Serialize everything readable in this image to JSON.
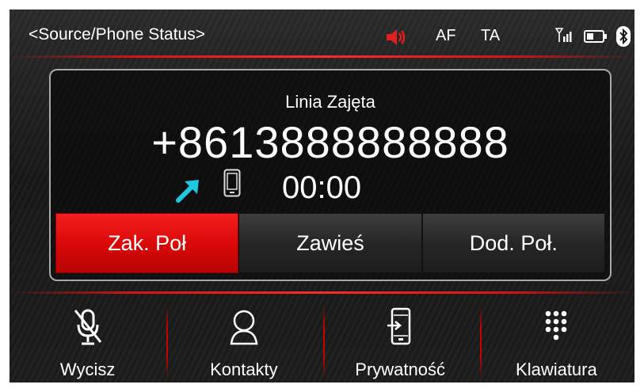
{
  "statusbar": {
    "source_label": "<Source/Phone Status>",
    "af": "AF",
    "ta": "TA",
    "icons": [
      "speaker-muted-icon",
      "signal-icon",
      "battery-icon",
      "bluetooth-icon"
    ]
  },
  "call": {
    "status": "Linia Zajęta",
    "number": "+8613888888888",
    "timer": "00:00",
    "direction_icon": "outgoing-call-arrow-icon",
    "device_icon": "mobile-phone-icon"
  },
  "actions": [
    {
      "label": "Zak. Poł",
      "active": true
    },
    {
      "label": "Zawieś",
      "active": false
    },
    {
      "label": "Dod. Poł.",
      "active": false
    }
  ],
  "dock": [
    {
      "label": "Wycisz",
      "icon": "mic-off-icon"
    },
    {
      "label": "Kontakty",
      "icon": "contacts-icon"
    },
    {
      "label": "Prywatność",
      "icon": "privacy-phone-icon"
    },
    {
      "label": "Klawiatura",
      "icon": "keypad-icon"
    }
  ],
  "colors": {
    "accent_red": "#e01010",
    "arrow_cyan": "#1fc8e0",
    "speaker_red": "#e02020"
  }
}
